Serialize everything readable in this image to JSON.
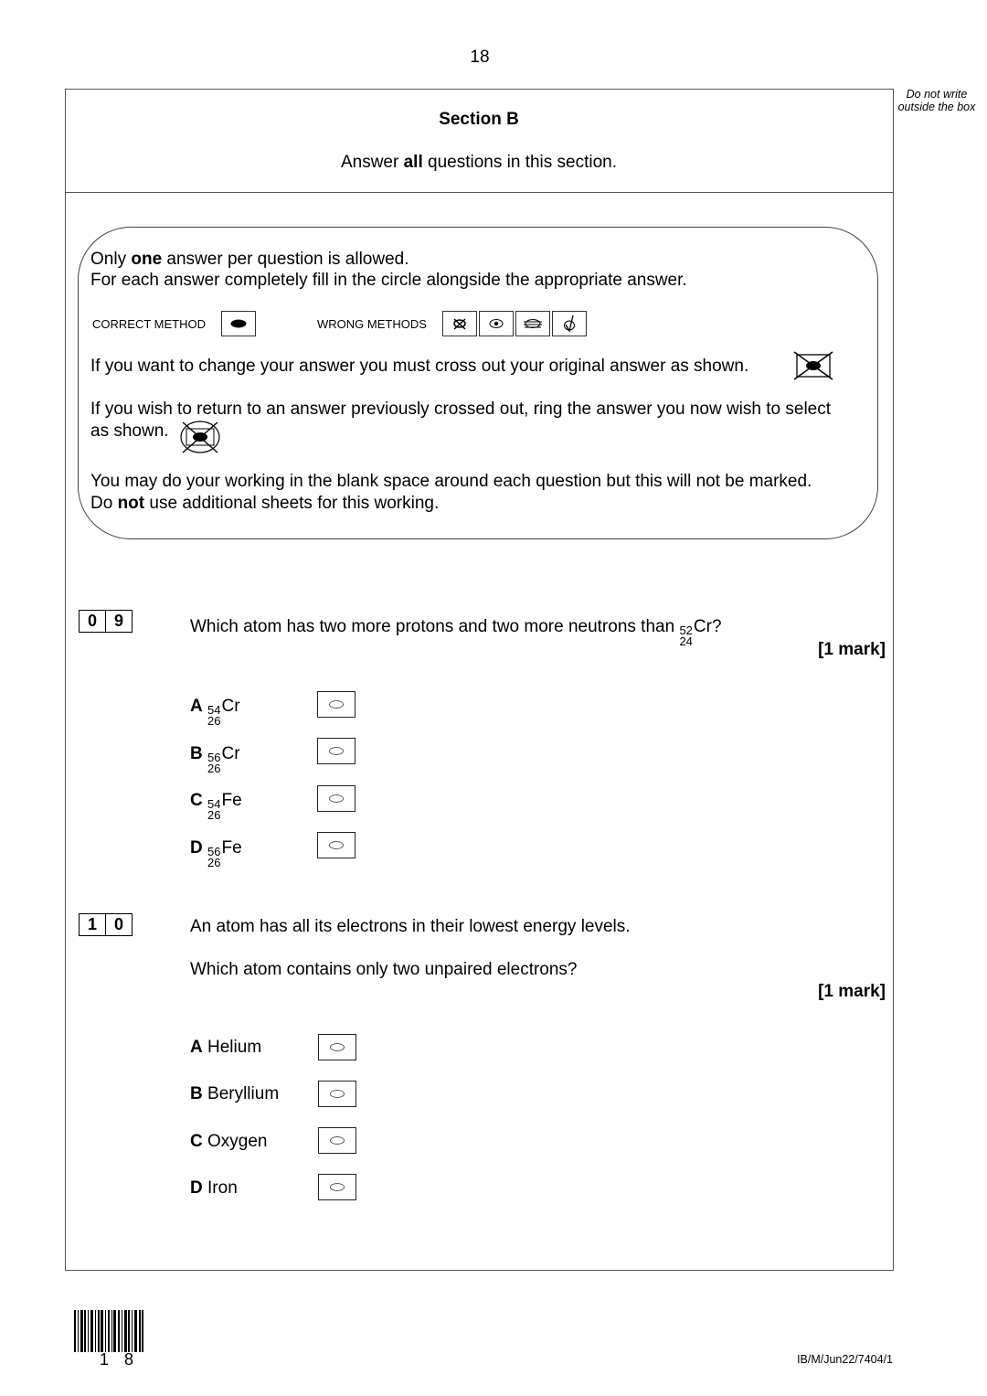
{
  "page_number": "18",
  "margin_note": "Do not write outside the box",
  "section": {
    "title": "Section B",
    "instruction_prefix": "Answer ",
    "instruction_bold": "all",
    "instruction_suffix": " questions in this section."
  },
  "instructions": {
    "line1_prefix": "Only ",
    "line1_bold": "one",
    "line1_suffix": " answer per question is allowed.",
    "line2": "For each answer completely fill in the circle alongside the appropriate answer.",
    "correct_method_label": "CORRECT METHOD",
    "wrong_methods_label": "WRONG METHODS",
    "change_answer": "If you want to change your answer you must cross out your original answer as shown.",
    "return_answer_line1": "If you wish to return to an answer previously crossed out, ring the answer you now wish to select",
    "return_answer_line2": "as shown.",
    "working_line1": "You may do your working in the blank space around each question but this will not be marked.",
    "working_line2_prefix": "Do ",
    "working_line2_bold": "not",
    "working_line2_suffix": " use additional sheets for this working."
  },
  "questions": [
    {
      "number_digits": [
        "0",
        "9"
      ],
      "text_prefix": "Which atom has two more protons and two more neutrons than ",
      "ref_isotope": {
        "mass": "52",
        "atomic": "24",
        "symbol": "Cr"
      },
      "text_suffix": "?",
      "marks": "[1 mark]",
      "options": [
        {
          "letter": "A",
          "mass": "54",
          "atomic": "26",
          "symbol": "Cr"
        },
        {
          "letter": "B",
          "mass": "56",
          "atomic": "26",
          "symbol": "Cr"
        },
        {
          "letter": "C",
          "mass": "54",
          "atomic": "26",
          "symbol": "Fe"
        },
        {
          "letter": "D",
          "mass": "56",
          "atomic": "26",
          "symbol": "Fe"
        }
      ]
    },
    {
      "number_digits": [
        "1",
        "0"
      ],
      "text_line1": "An atom has all its electrons in their lowest energy levels.",
      "text_line2": "Which atom contains only two unpaired electrons?",
      "marks": "[1 mark]",
      "options": [
        {
          "letter": "A",
          "label": "Helium"
        },
        {
          "letter": "B",
          "label": "Beryllium"
        },
        {
          "letter": "C",
          "label": "Oxygen"
        },
        {
          "letter": "D",
          "label": "Iron"
        }
      ]
    }
  ],
  "footer": {
    "barcode_digits": "1 8",
    "paper_code": "IB/M/Jun22/7404/1"
  }
}
